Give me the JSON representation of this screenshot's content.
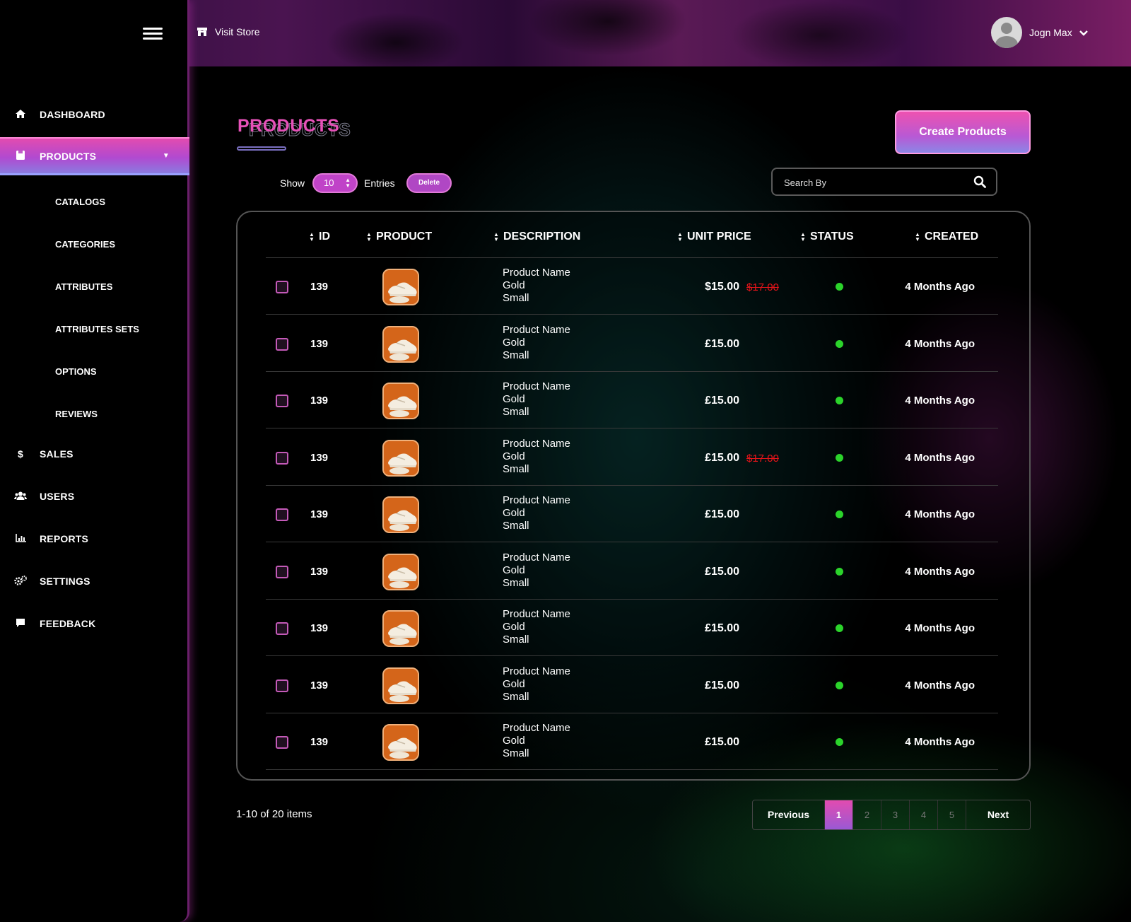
{
  "header": {
    "visit_store": "Visit Store",
    "user_name": "Jogn Max"
  },
  "sidebar": {
    "items": [
      {
        "label": "DASHBOARD",
        "icon": "home-icon"
      },
      {
        "label": "PRODUCTS",
        "icon": "box-icon",
        "active": true
      },
      {
        "label": "SALES",
        "icon": "dollar-icon"
      },
      {
        "label": "USERS",
        "icon": "users-icon"
      },
      {
        "label": "REPORTS",
        "icon": "chart-icon"
      },
      {
        "label": "SETTINGS",
        "icon": "gears-icon"
      },
      {
        "label": "FEEDBACK",
        "icon": "comment-icon"
      }
    ],
    "sub_items": [
      "CATALOGS",
      "CATEGORIES",
      "ATTRIBUTES",
      "ATTRIBUTES SETS",
      "OPTIONS",
      "REVIEWS"
    ]
  },
  "main": {
    "title": "PRODUCTS",
    "create_button": "Create Products",
    "show_label": "Show",
    "entries_value": "10",
    "entries_label": "Entries",
    "delete_button": "Delete",
    "search_placeholder": "Search By"
  },
  "table": {
    "columns": [
      "ID",
      "PRODUCT",
      "DESCRIPTION",
      "UNIT PRICE",
      "STATUS",
      "CREATED"
    ],
    "rows": [
      {
        "id": "139",
        "desc": [
          "Product Name",
          "Gold",
          "Small"
        ],
        "price": "$15.00",
        "old_price": "$17.00",
        "created": "4 Months Ago"
      },
      {
        "id": "139",
        "desc": [
          "Product Name",
          "Gold",
          "Small"
        ],
        "price": "£15.00",
        "old_price": "",
        "created": "4 Months Ago"
      },
      {
        "id": "139",
        "desc": [
          "Product Name",
          "Gold",
          "Small"
        ],
        "price": "£15.00",
        "old_price": "",
        "created": "4 Months Ago"
      },
      {
        "id": "139",
        "desc": [
          "Product Name",
          "Gold",
          "Small"
        ],
        "price": "£15.00",
        "old_price": "$17.00",
        "created": "4 Months Ago"
      },
      {
        "id": "139",
        "desc": [
          "Product Name",
          "Gold",
          "Small"
        ],
        "price": "£15.00",
        "old_price": "",
        "created": "4 Months Ago"
      },
      {
        "id": "139",
        "desc": [
          "Product Name",
          "Gold",
          "Small"
        ],
        "price": "£15.00",
        "old_price": "",
        "created": "4 Months Ago"
      },
      {
        "id": "139",
        "desc": [
          "Product Name",
          "Gold",
          "Small"
        ],
        "price": "£15.00",
        "old_price": "",
        "created": "4 Months Ago"
      },
      {
        "id": "139",
        "desc": [
          "Product Name",
          "Gold",
          "Small"
        ],
        "price": "£15.00",
        "old_price": "",
        "created": "4 Months Ago"
      },
      {
        "id": "139",
        "desc": [
          "Product Name",
          "Gold",
          "Small"
        ],
        "price": "£15.00",
        "old_price": "",
        "created": "4 Months Ago"
      }
    ]
  },
  "footer": {
    "count_text": "1-10 of 20 items",
    "previous": "Previous",
    "next": "Next",
    "pages": [
      "1",
      "2",
      "3",
      "4",
      "5"
    ],
    "current_page": "1"
  },
  "colors": {
    "accent_pink": "#e651b8",
    "accent_purple": "#9a59d4",
    "status_active": "#2bd42b",
    "old_price": "#e8141a"
  }
}
